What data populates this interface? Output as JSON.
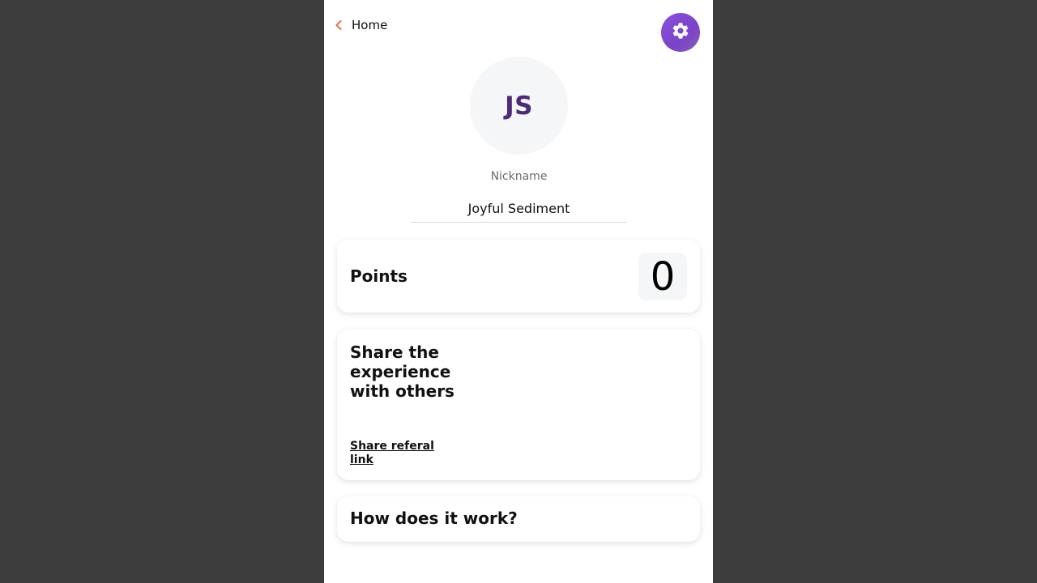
{
  "header": {
    "back_label": "Home"
  },
  "profile": {
    "initials": "JS",
    "nickname_label": "Nickname",
    "nickname_value": "Joyful Sediment"
  },
  "points_card": {
    "title": "Points",
    "value": "0"
  },
  "share_card": {
    "title": "Share the experience with others",
    "link_label": "Share referal link"
  },
  "how_card": {
    "title": "How does it work?"
  },
  "icons": {
    "back": "chevron-left-icon",
    "settings": "gear-icon"
  },
  "colors": {
    "accent": "#7b47d1",
    "back_chevron": "#e8704a",
    "avatar_text": "#4e2a7b",
    "background": "#3d3d3d"
  }
}
